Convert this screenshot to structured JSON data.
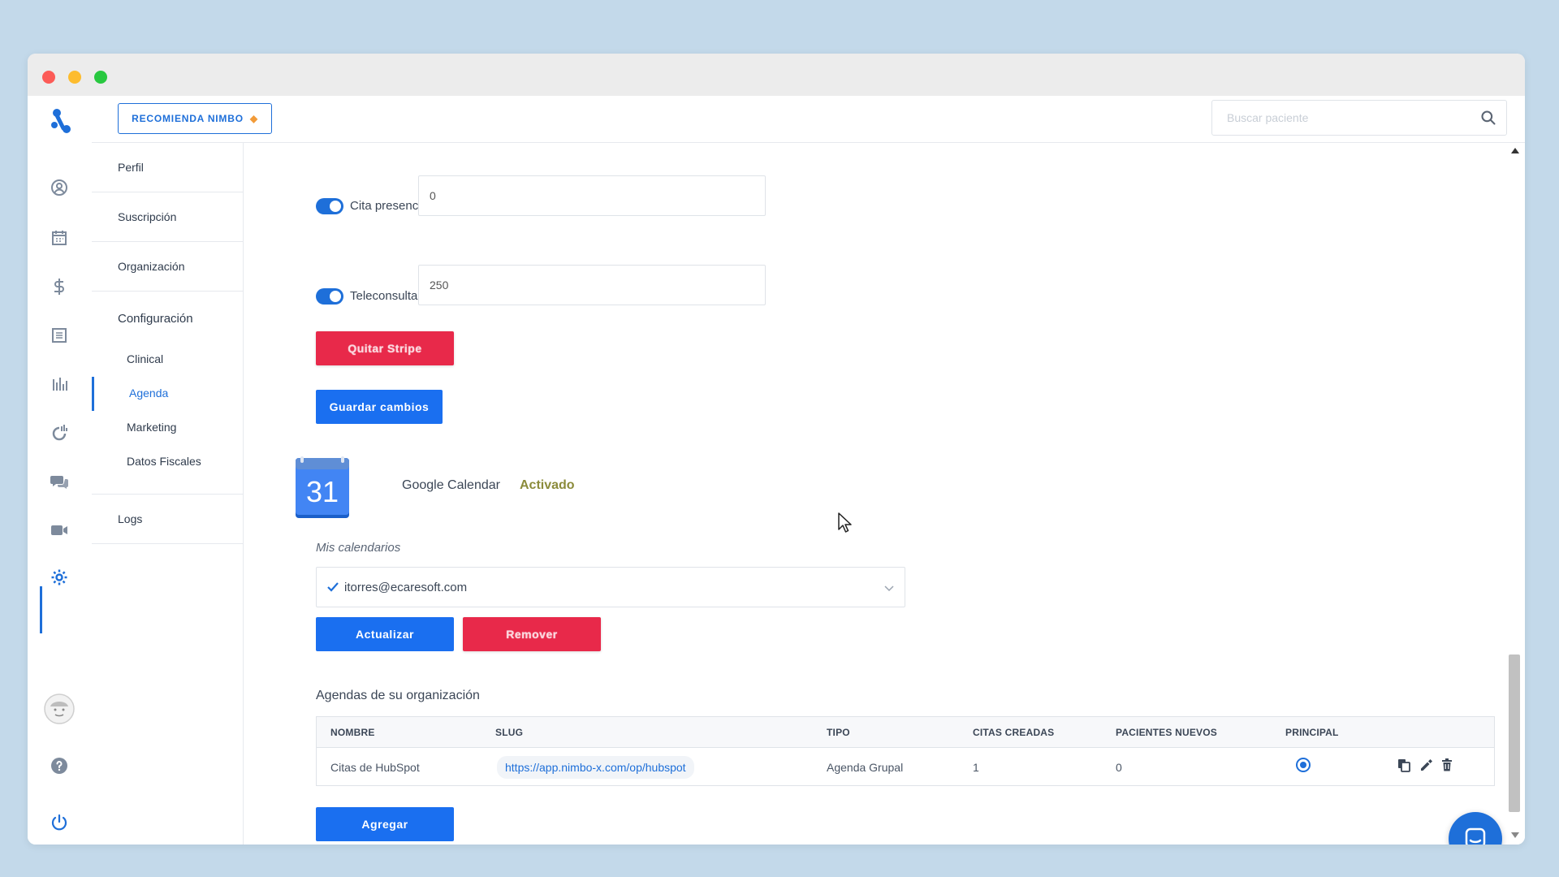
{
  "header": {
    "recommend_label": "RECOMIENDA NIMBO",
    "search_placeholder": "Buscar paciente"
  },
  "rail": {
    "icons": [
      "logo",
      "user-icon",
      "calendar-icon",
      "dollar-icon",
      "list-icon",
      "bar-chart-icon",
      "pie-chart-icon",
      "chat-icon",
      "video-icon",
      "gear-icon",
      "avatar",
      "help-icon",
      "power-icon"
    ]
  },
  "submenu": {
    "perfil": "Perfil",
    "suscripcion": "Suscripción",
    "organizacion": "Organización",
    "configuracion": "Configuración",
    "clinical": "Clinical",
    "agenda": "Agenda",
    "marketing": "Marketing",
    "datos_fiscales": "Datos Fiscales",
    "logs": "Logs"
  },
  "form": {
    "cita_presencial_label": "Cita presencial",
    "cita_presencial_value": "0",
    "teleconsulta_label": "Teleconsulta",
    "teleconsulta_value": "250",
    "quitar_stripe_label": "Quitar Stripe",
    "guardar_label": "Guardar cambios"
  },
  "google_calendar": {
    "day": "31",
    "title": "Google Calendar",
    "status": "Activado",
    "mis_calendarios": "Mis calendarios",
    "selected_calendar": "itorres@ecaresoft.com",
    "actualizar_label": "Actualizar",
    "remover_label": "Remover"
  },
  "agendas": {
    "title": "Agendas de su organización",
    "columns": [
      "Nombre",
      "Slug",
      "Tipo",
      "Citas creadas",
      "Pacientes nuevos",
      "Principal"
    ],
    "rows": [
      {
        "nombre": "Citas de HubSpot",
        "slug": "https://app.nimbo-x.com/op/hubspot",
        "tipo": "Agenda Grupal",
        "citas_creadas": "1",
        "pacientes_nuevos": "0",
        "principal": true
      }
    ],
    "agregar_label": "Agregar"
  },
  "colors": {
    "primary": "#1a6ff0",
    "danger": "#e8294a",
    "status_active": "#8b8b3a"
  }
}
